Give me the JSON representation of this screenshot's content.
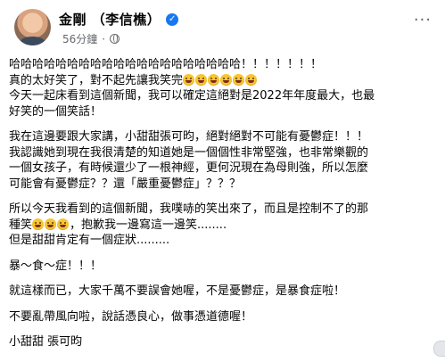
{
  "header": {
    "name": "金剛 （李信樵）",
    "time": "56分鐘",
    "separator": "·"
  },
  "post": {
    "l1": "哈哈哈哈哈哈哈哈哈哈哈哈哈哈哈哈哈哈哈哈！！！！！！！",
    "l2": "真的太好笑了，對不起先讓我笑完",
    "l3": "今天一起床看到這個新聞，我可以確定這絕對是2022年年度最大，也最",
    "l4": "好笑的一個笑話！",
    "l5": "我在這邊要跟大家講，小甜甜張可昀，絕對絕對不可能有憂鬱症！！！",
    "l6": "我認識她到現在我很清楚的知道她是一個個性非常堅強，也非常樂觀的",
    "l7": "一個女孩子，有時候還少了一根神經，更何況現在為母則強，所以怎麼",
    "l8": "可能會有憂鬱症？？還「嚴重憂鬱症」？？？",
    "l9": "所以今天我看到的這個新聞，我噗哧的笑出來了，而且是控制不了的那",
    "l10a": "種笑",
    "l10b": "，抱歉我一邊寫這一邊笑........",
    "l11": "但是甜甜肯定有一個症狀.........",
    "l12": "暴～食～症！！！",
    "l13": "就這樣而已，大家千萬不要誤會她喔，不是憂鬱症，是暴食症啦！",
    "l14": "不要亂帶風向啦，說話憑良心，做事憑道德喔！",
    "l15": "小甜甜 張可昀"
  },
  "icons": {
    "verified": "verified-badge-icon",
    "globe": "globe-icon",
    "more": "more-options-icon",
    "emoji": "laughing-face-emoji"
  },
  "colors": {
    "verified": "#1877f2",
    "meta": "#65676b",
    "text": "#050505"
  }
}
